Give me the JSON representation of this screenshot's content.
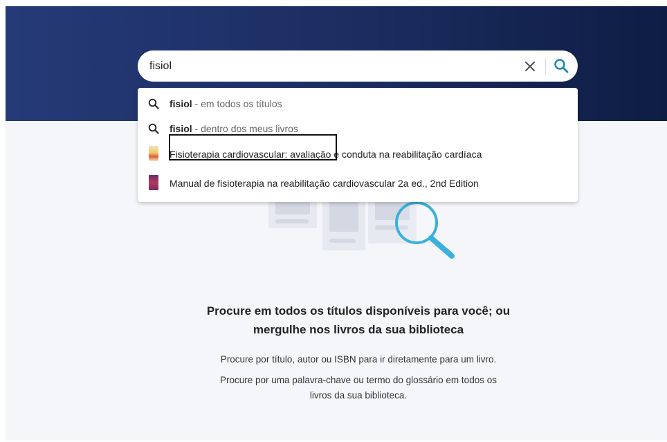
{
  "search": {
    "value": "fisiol",
    "placeholder": ""
  },
  "suggestions": [
    {
      "query": "fisiol",
      "scope": " - em todos os títulos",
      "icon": "search-icon"
    },
    {
      "query": "fisiol",
      "scope": " - dentro dos meus livros",
      "icon": "search-icon"
    }
  ],
  "books": [
    {
      "title": "Fisioterapia cardiovascular: avaliação e conduta na reabilitação cardíaca",
      "icon": "book-cover-icon"
    },
    {
      "title": "Manual de fisioterapia na reabilitação cardiovascular 2a ed., 2nd Edition",
      "icon": "book-cover-icon"
    }
  ],
  "empty_state": {
    "title_line1": "Procure em todos os títulos disponíveis para você; ou",
    "title_line2": "mergulhe nos livros da sua biblioteca",
    "text1": "Procure por título, autor ou ISBN para ir diretamente para um livro.",
    "text2_line1": "Procure por uma palavra-chave ou termo do glossário em todos os",
    "text2_line2": "livros da sua biblioteca."
  },
  "colors": {
    "banner_start": "#253a78",
    "banner_end": "#0e1d44",
    "accent": "#1d8ab5",
    "content_bg": "#f5f6f9"
  }
}
